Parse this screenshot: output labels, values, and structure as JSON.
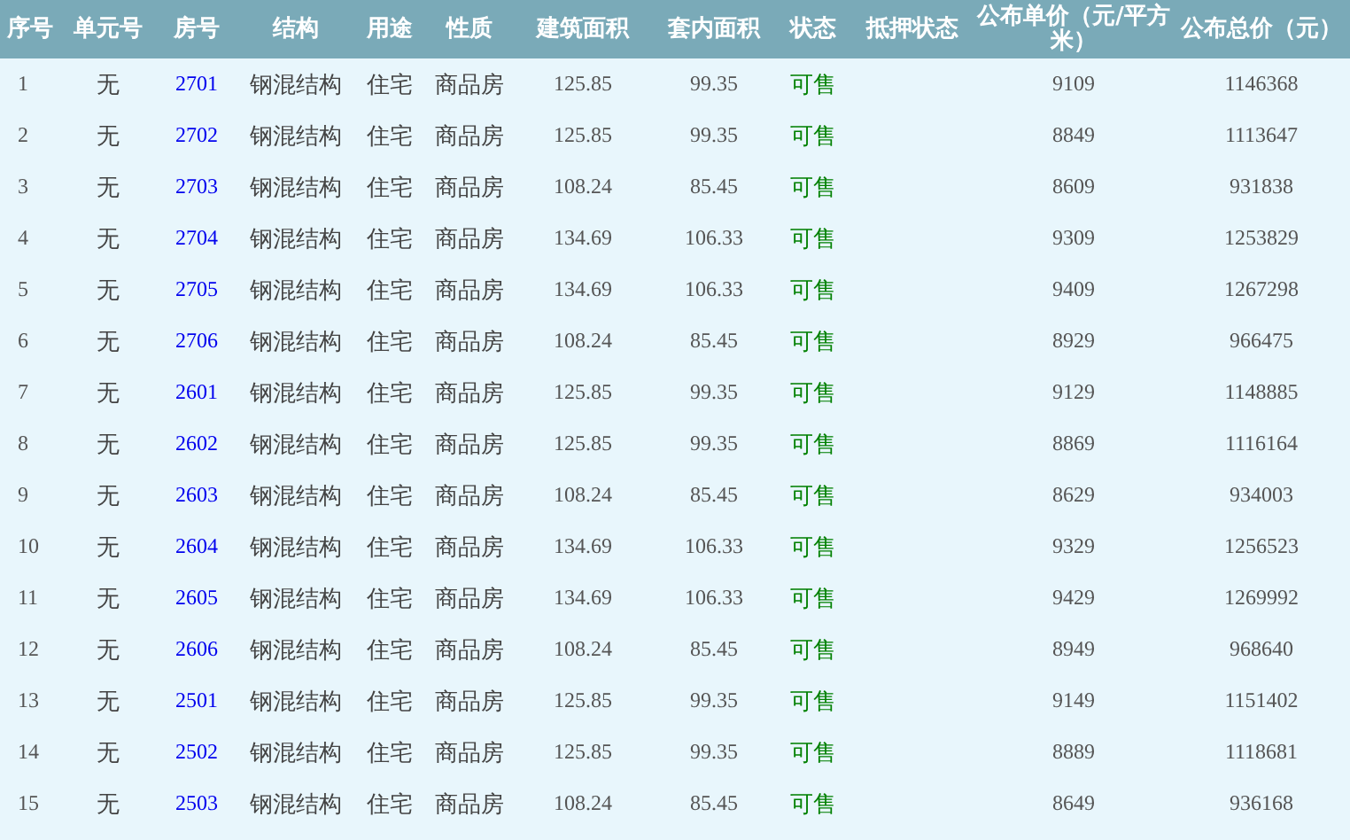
{
  "table": {
    "columns": [
      "序号",
      "单元号",
      "房号",
      "结构",
      "用途",
      "性质",
      "建筑面积",
      "套内面积",
      "状态",
      "抵押状态",
      "公布单价（元/平方米）",
      "公布总价（元）"
    ],
    "rows": [
      {
        "index": "1",
        "unit": "无",
        "room": "2701",
        "structure": "钢混结构",
        "use": "住宅",
        "nature": "商品房",
        "floor_area": "125.85",
        "inner_area": "99.35",
        "status": "可售",
        "unit_price": "9109",
        "total_price": "1146368"
      },
      {
        "index": "2",
        "unit": "无",
        "room": "2702",
        "structure": "钢混结构",
        "use": "住宅",
        "nature": "商品房",
        "floor_area": "125.85",
        "inner_area": "99.35",
        "status": "可售",
        "unit_price": "8849",
        "total_price": "1113647"
      },
      {
        "index": "3",
        "unit": "无",
        "room": "2703",
        "structure": "钢混结构",
        "use": "住宅",
        "nature": "商品房",
        "floor_area": "108.24",
        "inner_area": "85.45",
        "status": "可售",
        "unit_price": "8609",
        "total_price": "931838"
      },
      {
        "index": "4",
        "unit": "无",
        "room": "2704",
        "structure": "钢混结构",
        "use": "住宅",
        "nature": "商品房",
        "floor_area": "134.69",
        "inner_area": "106.33",
        "status": "可售",
        "unit_price": "9309",
        "total_price": "1253829"
      },
      {
        "index": "5",
        "unit": "无",
        "room": "2705",
        "structure": "钢混结构",
        "use": "住宅",
        "nature": "商品房",
        "floor_area": "134.69",
        "inner_area": "106.33",
        "status": "可售",
        "unit_price": "9409",
        "total_price": "1267298"
      },
      {
        "index": "6",
        "unit": "无",
        "room": "2706",
        "structure": "钢混结构",
        "use": "住宅",
        "nature": "商品房",
        "floor_area": "108.24",
        "inner_area": "85.45",
        "status": "可售",
        "unit_price": "8929",
        "total_price": "966475"
      },
      {
        "index": "7",
        "unit": "无",
        "room": "2601",
        "structure": "钢混结构",
        "use": "住宅",
        "nature": "商品房",
        "floor_area": "125.85",
        "inner_area": "99.35",
        "status": "可售",
        "unit_price": "9129",
        "total_price": "1148885"
      },
      {
        "index": "8",
        "unit": "无",
        "room": "2602",
        "structure": "钢混结构",
        "use": "住宅",
        "nature": "商品房",
        "floor_area": "125.85",
        "inner_area": "99.35",
        "status": "可售",
        "unit_price": "8869",
        "total_price": "1116164"
      },
      {
        "index": "9",
        "unit": "无",
        "room": "2603",
        "structure": "钢混结构",
        "use": "住宅",
        "nature": "商品房",
        "floor_area": "108.24",
        "inner_area": "85.45",
        "status": "可售",
        "unit_price": "8629",
        "total_price": "934003"
      },
      {
        "index": "10",
        "unit": "无",
        "room": "2604",
        "structure": "钢混结构",
        "use": "住宅",
        "nature": "商品房",
        "floor_area": "134.69",
        "inner_area": "106.33",
        "status": "可售",
        "unit_price": "9329",
        "total_price": "1256523"
      },
      {
        "index": "11",
        "unit": "无",
        "room": "2605",
        "structure": "钢混结构",
        "use": "住宅",
        "nature": "商品房",
        "floor_area": "134.69",
        "inner_area": "106.33",
        "status": "可售",
        "unit_price": "9429",
        "total_price": "1269992"
      },
      {
        "index": "12",
        "unit": "无",
        "room": "2606",
        "structure": "钢混结构",
        "use": "住宅",
        "nature": "商品房",
        "floor_area": "108.24",
        "inner_area": "85.45",
        "status": "可售",
        "unit_price": "8949",
        "total_price": "968640"
      },
      {
        "index": "13",
        "unit": "无",
        "room": "2501",
        "structure": "钢混结构",
        "use": "住宅",
        "nature": "商品房",
        "floor_area": "125.85",
        "inner_area": "99.35",
        "status": "可售",
        "unit_price": "9149",
        "total_price": "1151402"
      },
      {
        "index": "14",
        "unit": "无",
        "room": "2502",
        "structure": "钢混结构",
        "use": "住宅",
        "nature": "商品房",
        "floor_area": "125.85",
        "inner_area": "99.35",
        "status": "可售",
        "unit_price": "8889",
        "total_price": "1118681"
      },
      {
        "index": "15",
        "unit": "无",
        "room": "2503",
        "structure": "钢混结构",
        "use": "住宅",
        "nature": "商品房",
        "floor_area": "108.24",
        "inner_area": "85.45",
        "status": "可售",
        "unit_price": "8649",
        "total_price": "936168"
      }
    ]
  }
}
